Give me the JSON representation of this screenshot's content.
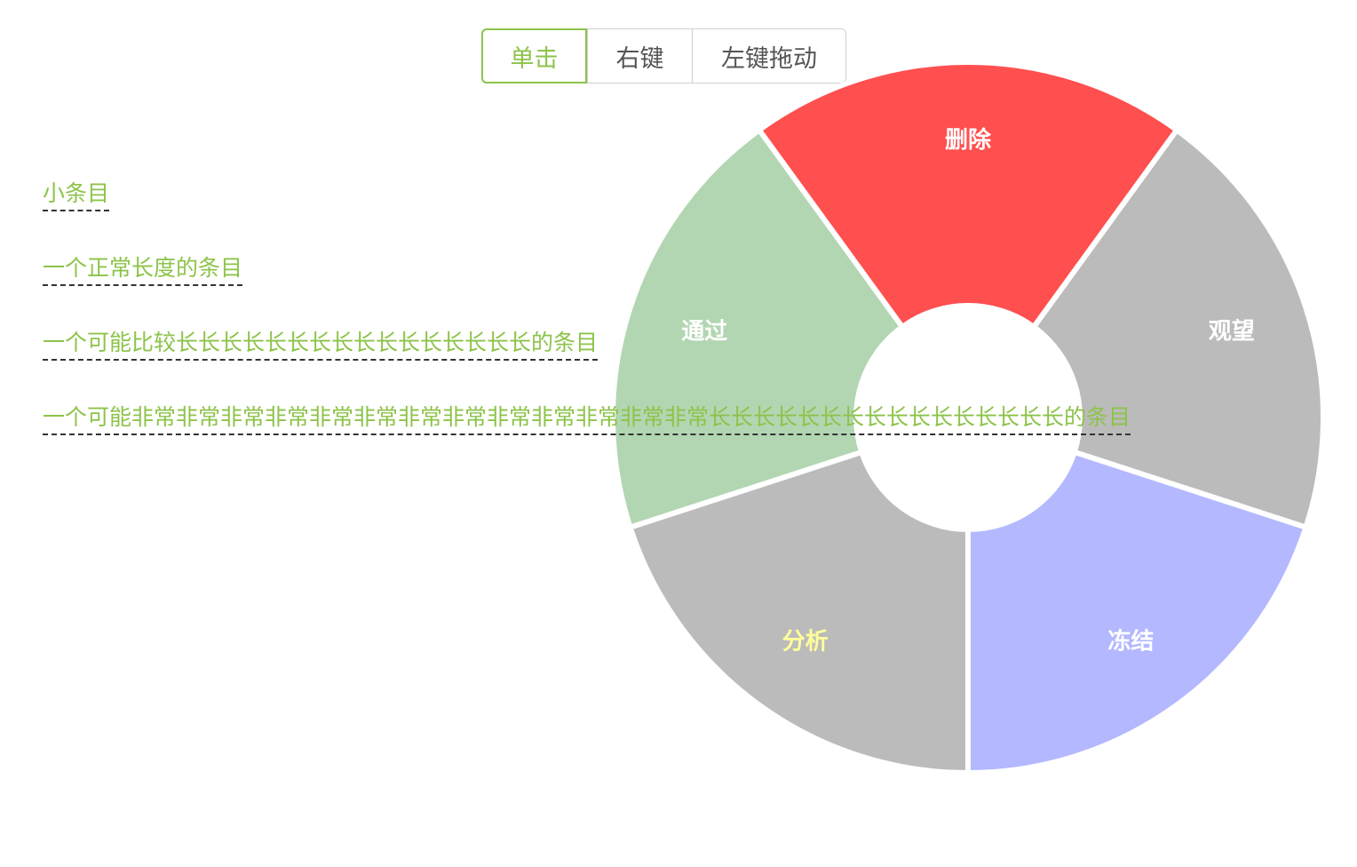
{
  "toolbar": {
    "buttons": [
      {
        "label": "单击",
        "active": true
      },
      {
        "label": "右键",
        "active": false
      },
      {
        "label": "左键拖动",
        "active": false
      }
    ]
  },
  "list": {
    "items": [
      "小条目",
      "一个正常长度的条目",
      "一个可能比较长长长长长长长长长长长长长长长长的条目",
      "一个可能非常非常非常非常非常非常非常非常非常非常非常非常非常长长长长长长长长长长长长长长长长的条目"
    ]
  },
  "wheel": {
    "segments": [
      {
        "label": "删除",
        "color": "#ff4f4f",
        "label_color": "#ffffff"
      },
      {
        "label": "观望",
        "color": "#bbbbbb",
        "label_color": "#ffffff"
      },
      {
        "label": "冻结",
        "color": "#b3b8ff",
        "label_color": "#ffffff"
      },
      {
        "label": "分析",
        "color": "#bbbbbb",
        "label_color": "#ffff99"
      },
      {
        "label": "通过",
        "color": "#b2d6b2",
        "label_color": "#ffffff"
      }
    ]
  },
  "colors": {
    "accent": "#8dc34a"
  }
}
